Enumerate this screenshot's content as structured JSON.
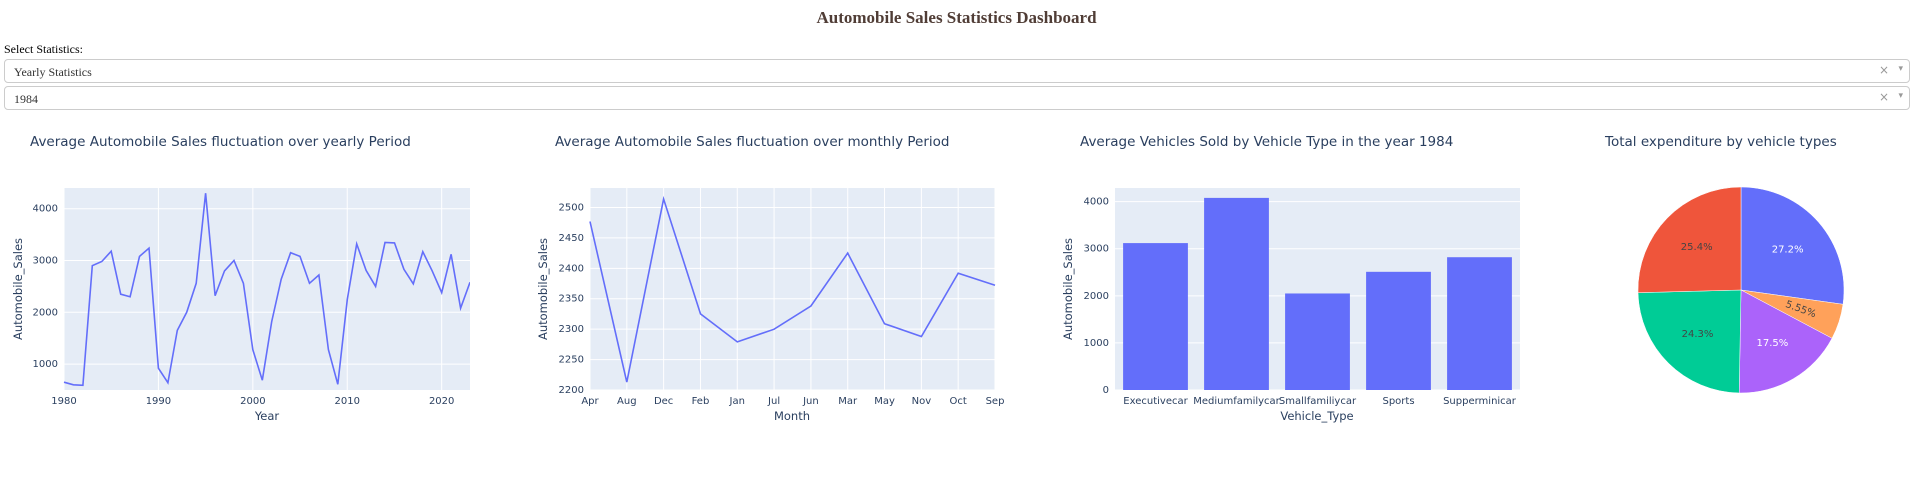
{
  "header": {
    "title": "Automobile Sales Statistics Dashboard"
  },
  "controls": {
    "select_label": "Select Statistics:",
    "statistics_dropdown": {
      "value": "Yearly Statistics"
    },
    "year_dropdown": {
      "value": "1984"
    },
    "clear_glyph": "×",
    "arrow_glyph": "▾"
  },
  "colors": {
    "plot_bg": "#E5ECF6",
    "line": "#636EFA",
    "bar": "#636EFA",
    "grid": "#ffffff",
    "pie": [
      "#636EFA",
      "#FFA15A",
      "#AB63FA",
      "#00CC96",
      "#EF553B"
    ]
  },
  "chart_data": [
    {
      "type": "line",
      "title": "Average Automobile Sales fluctuation over yearly Period",
      "xlabel": "Year",
      "ylabel": "Automobile_Sales",
      "xlim": [
        1980,
        2023
      ],
      "ylim": [
        500,
        4400
      ],
      "xticks": [
        1980,
        1990,
        2000,
        2010,
        2020
      ],
      "yticks": [
        1000,
        2000,
        3000,
        4000
      ],
      "x": [
        1980,
        1981,
        1982,
        1983,
        1984,
        1985,
        1986,
        1987,
        1988,
        1989,
        1990,
        1991,
        1992,
        1993,
        1994,
        1995,
        1996,
        1997,
        1998,
        1999,
        2000,
        2001,
        2002,
        2003,
        2004,
        2005,
        2006,
        2007,
        2008,
        2009,
        2010,
        2011,
        2012,
        2013,
        2014,
        2015,
        2016,
        2017,
        2018,
        2019,
        2020,
        2021,
        2022,
        2023
      ],
      "y": [
        650,
        600,
        590,
        2900,
        2980,
        3180,
        2350,
        2300,
        3080,
        3240,
        920,
        640,
        1650,
        2000,
        2560,
        4300,
        2320,
        2800,
        3000,
        2560,
        1280,
        690,
        1820,
        2640,
        3150,
        3080,
        2560,
        2720,
        1280,
        610,
        2250,
        3320,
        2810,
        2500,
        3350,
        3340,
        2830,
        2550,
        3170,
        2800,
        2380,
        3120,
        2080,
        2580
      ]
    },
    {
      "type": "line",
      "title": "Average Automobile Sales fluctuation over monthly Period",
      "xlabel": "Month",
      "ylabel": "Automobile_Sales",
      "categories": [
        "Apr",
        "Aug",
        "Dec",
        "Feb",
        "Jan",
        "Jul",
        "Jun",
        "Mar",
        "May",
        "Nov",
        "Oct",
        "Sep"
      ],
      "ylim": [
        2200,
        2532
      ],
      "yticks": [
        2200,
        2250,
        2300,
        2350,
        2400,
        2450,
        2500
      ],
      "values": [
        2477,
        2213,
        2514,
        2325,
        2279,
        2300,
        2338,
        2425,
        2309,
        2288,
        2392,
        2372
      ]
    },
    {
      "type": "bar",
      "title": "Average Vehicles Sold by Vehicle Type in the year 1984",
      "xlabel": "Vehicle_Type",
      "ylabel": "Automobile_Sales",
      "categories": [
        "Executivecar",
        "Mediumfamilycar",
        "Smallfamiliycar",
        "Sports",
        "Supperminicar"
      ],
      "ylim": [
        0,
        4290
      ],
      "yticks": [
        0,
        1000,
        2000,
        3000,
        4000
      ],
      "values": [
        3120,
        4080,
        2050,
        2510,
        2820
      ]
    },
    {
      "type": "pie",
      "title": "Total expenditure by vehicle types",
      "values": [
        27.2,
        5.55,
        17.5,
        24.3,
        25.4
      ],
      "labels": [
        "27.2%",
        "5.55%",
        "17.5%",
        "24.3%",
        "25.4%"
      ]
    }
  ]
}
